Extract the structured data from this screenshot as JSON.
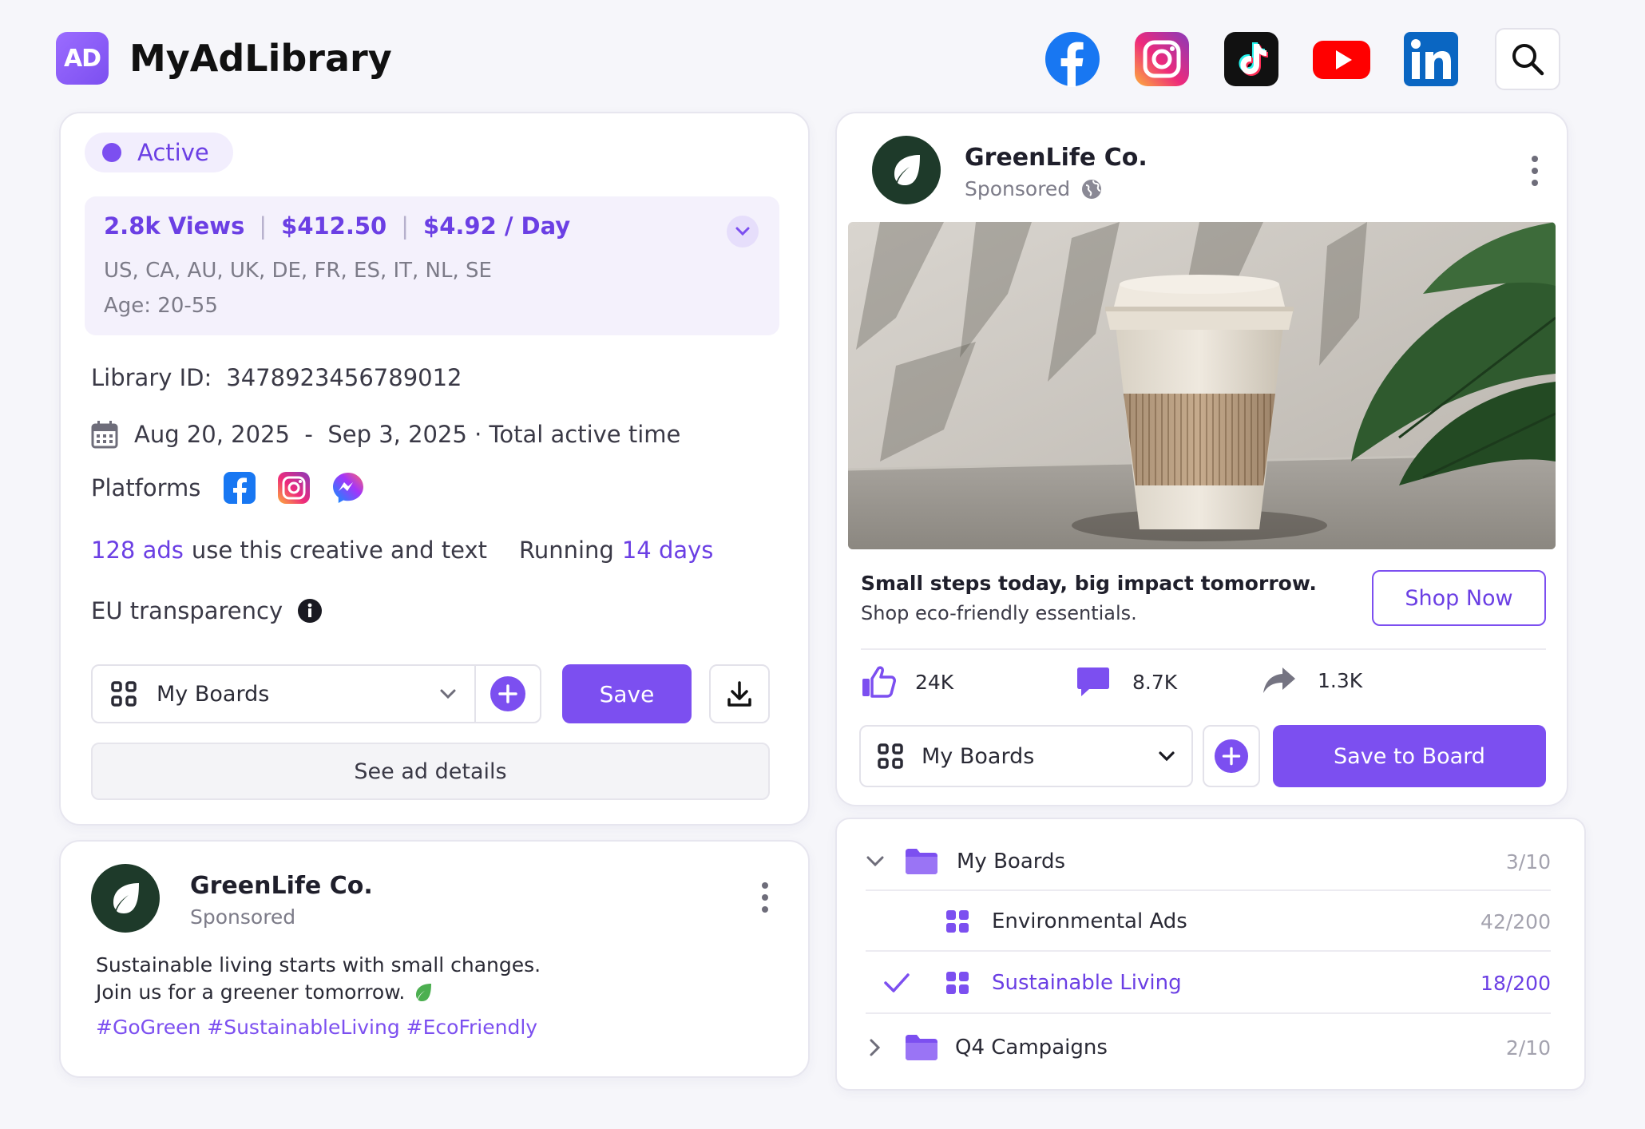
{
  "app": {
    "logo_text": "AD",
    "title": "MyAdLibrary"
  },
  "header_icons": [
    "facebook-icon",
    "instagram-icon",
    "tiktok-icon",
    "youtube-icon",
    "linkedin-icon",
    "search-icon"
  ],
  "colors": {
    "accent": "#7c4ff0",
    "accent_light": "#f2eefd",
    "active_dot": "#7c4ff0",
    "text": "#1f1f2b",
    "muted": "#6e6d7a"
  },
  "details": {
    "status": "Active",
    "views": "2.8k Views",
    "spend": "$412.50",
    "per_day": "$4.92 / Day",
    "sep": "|",
    "countries": "US, CA, AU, UK, DE, FR, ES, IT, NL, SE",
    "age": "Age: 20-55",
    "library_id_label": "Library ID:",
    "library_id": "3478923456789012",
    "date_range": "Aug 20, 2025  -  Sep 3, 2025 · Total active time",
    "platforms_label": "Platforms",
    "ads_count": "128 ads",
    "ads_text": "use this creative and text",
    "running_label": "Running",
    "running_value": "14 days",
    "eu_label": "EU transparency",
    "boards_select": "My Boards",
    "save_label": "Save",
    "see_details": "See ad details"
  },
  "ad_preview": {
    "brand": "GreenLife Co.",
    "sponsored": "Sponsored",
    "headline": "Small steps today, big impact tomorrow.",
    "subline": "Shop eco-friendly essentials.",
    "cta": "Shop Now",
    "likes": "24K",
    "comments": "8.7K",
    "shares": "1.3K",
    "boards_select": "My Boards",
    "save_to_board": "Save to Board"
  },
  "post": {
    "brand": "GreenLife Co.",
    "sponsored": "Sponsored",
    "line1": "Sustainable living starts with small changes.",
    "line2": "Join us for a greener tomorrow.",
    "hashtags": "#GoGreen #SustainableLiving #EcoFriendly"
  },
  "boards": [
    {
      "name": "My Boards",
      "count": "3/10",
      "type": "folder",
      "expanded": true
    },
    {
      "name": "Environmental Ads",
      "count": "42/200",
      "type": "board",
      "selected": false
    },
    {
      "name": "Sustainable Living",
      "count": "18/200",
      "type": "board",
      "selected": true
    },
    {
      "name": "Q4 Campaigns",
      "count": "2/10",
      "type": "folder",
      "expanded": false
    }
  ]
}
